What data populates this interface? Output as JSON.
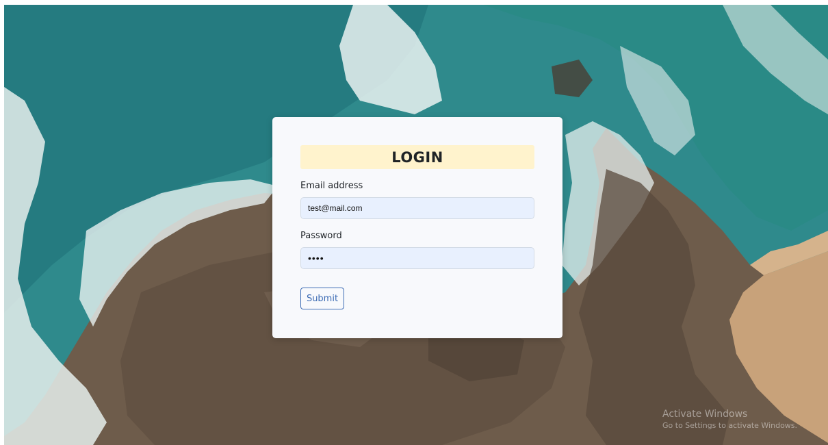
{
  "login": {
    "title": "LOGIN",
    "email_label": "Email address",
    "email_value": "test@mail.com",
    "password_label": "Password",
    "password_value": "••••",
    "submit_label": "Submit"
  },
  "watermark": {
    "title": "Activate Windows",
    "subtitle": "Go to Settings to activate Windows."
  },
  "colors": {
    "title_bar": "#fff3cd",
    "input_bg": "#e8f0fe",
    "submit_accent": "#3d6cb4",
    "card_bg": "#f8f9fc"
  }
}
